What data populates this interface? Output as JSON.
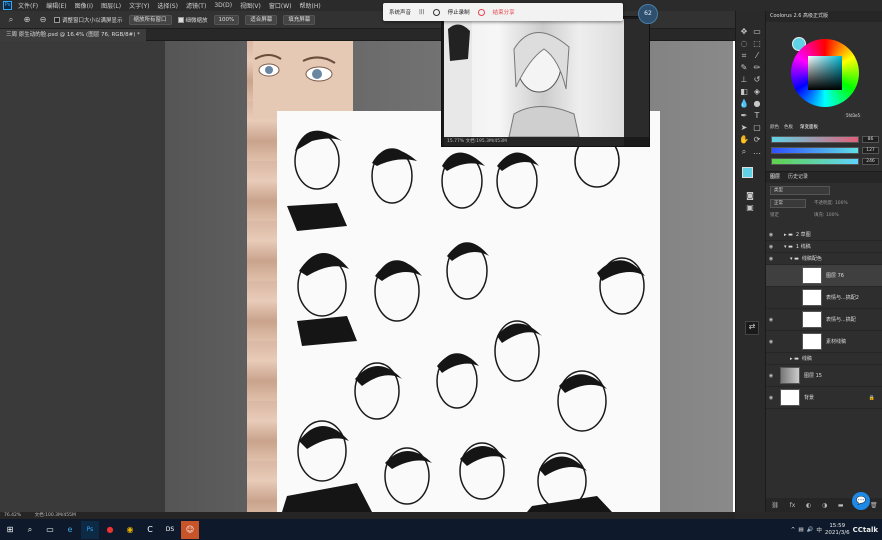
{
  "menubar": {
    "items": [
      "文件(F)",
      "编辑(E)",
      "图像(I)",
      "图层(L)",
      "文字(Y)",
      "选择(S)",
      "滤镜(T)",
      "3D(D)",
      "视图(V)",
      "窗口(W)",
      "帮助(H)"
    ]
  },
  "options": {
    "chk_resize": "调整窗口大小以满屏显示",
    "btn_zoom_all": "缩放所有窗口",
    "chk_scrubby": "细微缩放",
    "zoom_value": "100%",
    "btn_fit": "适合屏幕",
    "btn_fill": "填充屏幕"
  },
  "document": {
    "tab_label": "三周 原生动的脸.psd @ 16.4% (图层 76, RGB/8#) *",
    "zoom_status": "76.42%",
    "doc_info": "文档:100.3M/455M"
  },
  "recorder": {
    "audio_label": "系统声音",
    "stop_label": "停止录制",
    "share_label": "结束分享",
    "badge_value": "62",
    "preview_status": "15.77%    文档:195.3M/453M"
  },
  "color_panel": {
    "title": "Coolorus 2.6 高级正式版",
    "tab_color": "颜色",
    "tab_swatch": "色板",
    "tab_gradient": "渐变面板",
    "values": [
      "86",
      "127",
      "246"
    ],
    "hex_label": "5fd3e5",
    "fg_color": "#5fd3e5"
  },
  "layers_panel": {
    "tab_layers": "图层",
    "tab_history": "历史记录",
    "search_placeholder": "类型",
    "blend_mode": "正常",
    "opacity_label": "不透明度: 100%",
    "fill_label": "填充: 100%",
    "lock_label": "锁定",
    "layers": [
      {
        "name": "2 草图",
        "type": "group"
      },
      {
        "name": "1 线稿",
        "type": "group"
      },
      {
        "name": "线稿配色",
        "type": "group"
      },
      {
        "name": "图层 76",
        "type": "layer"
      },
      {
        "name": "表情与...搞配2",
        "type": "layer"
      },
      {
        "name": "表情与...搞配",
        "type": "layer"
      },
      {
        "name": "素材线稿",
        "type": "layer"
      },
      {
        "name": "线稿",
        "type": "group"
      },
      {
        "name": "图层 15",
        "type": "layer"
      },
      {
        "name": "背景",
        "type": "layer"
      }
    ]
  },
  "taskbar": {
    "apps": [
      "start-icon",
      "search-icon",
      "task-view-icon",
      "edge-icon",
      "photoshop-icon",
      "netease-icon",
      "chrome-icon",
      "cctalk-icon",
      "ds-icon",
      "user-app-icon"
    ],
    "time": "15:59",
    "date": "2021/3/6",
    "brand": "CCtalk"
  }
}
